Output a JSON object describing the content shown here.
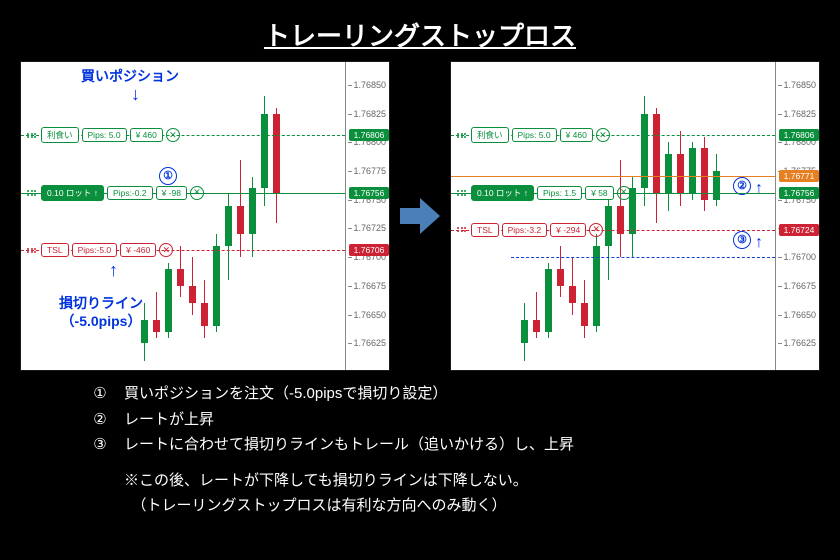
{
  "title": "トレーリングストップロス",
  "annot": {
    "buy_pos": "買いポジション",
    "sl_line_1": "損切りライン",
    "sl_line_2": "（-5.0pips）",
    "m1": "①",
    "m2": "②",
    "m3": "③"
  },
  "explain": {
    "n1": "①",
    "t1": "買いポジションを注文（-5.0pipsで損切り設定）",
    "n2": "②",
    "t2": "レートが上昇",
    "n3": "③",
    "t3": "レートに合わせて損切りラインもトレール（追いかける）し、上昇",
    "note1": "※この後、レートが下降しても損切りラインは下降しない。",
    "note2": "　（トレーリングストップロスは有利な方向へのみ動く）"
  },
  "chart_data": [
    {
      "type": "candlestick",
      "ylim": [
        1.766,
        1.7687
      ],
      "yticks": [
        1.76625,
        1.7665,
        1.76675,
        1.767,
        1.76725,
        1.7675,
        1.76775,
        1.768,
        1.76825,
        1.7685
      ],
      "lines": [
        {
          "label": "利食い",
          "pips": "Pips: 5.0",
          "amt": "¥ 460",
          "price": 1.76806,
          "color": "green",
          "style": "dash"
        },
        {
          "label": "0.10 ロット ↑",
          "pips": "Pips:-0.2",
          "amt": "¥ -98",
          "price": 1.76756,
          "color": "green",
          "style": "solid",
          "filled": true
        },
        {
          "label": "TSL",
          "pips": "Pips:-5.0",
          "amt": "¥ -460",
          "price": 1.76706,
          "color": "red",
          "style": "dash"
        }
      ],
      "candles": [
        {
          "x": 120,
          "o": 1.76625,
          "h": 1.7666,
          "l": 1.7661,
          "c": 1.76645,
          "up": true
        },
        {
          "x": 132,
          "o": 1.76645,
          "h": 1.7667,
          "l": 1.7663,
          "c": 1.76635,
          "up": false
        },
        {
          "x": 144,
          "o": 1.76635,
          "h": 1.76695,
          "l": 1.7663,
          "c": 1.7669,
          "up": true
        },
        {
          "x": 156,
          "o": 1.7669,
          "h": 1.7671,
          "l": 1.76665,
          "c": 1.76675,
          "up": false
        },
        {
          "x": 168,
          "o": 1.76675,
          "h": 1.767,
          "l": 1.7665,
          "c": 1.7666,
          "up": false
        },
        {
          "x": 180,
          "o": 1.7666,
          "h": 1.7668,
          "l": 1.7663,
          "c": 1.7664,
          "up": false
        },
        {
          "x": 192,
          "o": 1.7664,
          "h": 1.7672,
          "l": 1.76635,
          "c": 1.7671,
          "up": true
        },
        {
          "x": 204,
          "o": 1.7671,
          "h": 1.76755,
          "l": 1.7668,
          "c": 1.76745,
          "up": true
        },
        {
          "x": 216,
          "o": 1.76745,
          "h": 1.76785,
          "l": 1.767,
          "c": 1.7672,
          "up": false
        },
        {
          "x": 228,
          "o": 1.7672,
          "h": 1.7677,
          "l": 1.767,
          "c": 1.7676,
          "up": true
        },
        {
          "x": 240,
          "o": 1.7676,
          "h": 1.7684,
          "l": 1.76745,
          "c": 1.76825,
          "up": true
        },
        {
          "x": 252,
          "o": 1.76825,
          "h": 1.7683,
          "l": 1.7673,
          "c": 1.76755,
          "up": false
        }
      ]
    },
    {
      "type": "candlestick",
      "ylim": [
        1.766,
        1.7687
      ],
      "yticks": [
        1.76625,
        1.7665,
        1.76675,
        1.767,
        1.76725,
        1.7675,
        1.76775,
        1.768,
        1.76825,
        1.7685
      ],
      "lines": [
        {
          "label": "利食い",
          "pips": "Pips: 5.0",
          "amt": "¥ 460",
          "price": 1.76806,
          "color": "green",
          "style": "dash"
        },
        {
          "label": "",
          "pips": "",
          "amt": "",
          "price": 1.76771,
          "color": "orange",
          "style": "solid",
          "priceonly": true
        },
        {
          "label": "0.10 ロット ↑",
          "pips": "Pips: 1.5",
          "amt": "¥ 58",
          "price": 1.76756,
          "color": "green",
          "style": "solid",
          "filled": true
        },
        {
          "label": "TSL",
          "pips": "Pips:-3.2",
          "amt": "¥ -294",
          "price": 1.76724,
          "color": "red",
          "style": "dash"
        },
        {
          "label": "",
          "pips": "",
          "amt": "",
          "price": 1.767,
          "color": "blue",
          "style": "dash",
          "refonly": true
        }
      ],
      "candles": [
        {
          "x": 70,
          "o": 1.76625,
          "h": 1.7666,
          "l": 1.7661,
          "c": 1.76645,
          "up": true
        },
        {
          "x": 82,
          "o": 1.76645,
          "h": 1.7667,
          "l": 1.7663,
          "c": 1.76635,
          "up": false
        },
        {
          "x": 94,
          "o": 1.76635,
          "h": 1.76695,
          "l": 1.7663,
          "c": 1.7669,
          "up": true
        },
        {
          "x": 106,
          "o": 1.7669,
          "h": 1.7671,
          "l": 1.76665,
          "c": 1.76675,
          "up": false
        },
        {
          "x": 118,
          "o": 1.76675,
          "h": 1.767,
          "l": 1.7665,
          "c": 1.7666,
          "up": false
        },
        {
          "x": 130,
          "o": 1.7666,
          "h": 1.7668,
          "l": 1.7663,
          "c": 1.7664,
          "up": false
        },
        {
          "x": 142,
          "o": 1.7664,
          "h": 1.7672,
          "l": 1.76635,
          "c": 1.7671,
          "up": true
        },
        {
          "x": 154,
          "o": 1.7671,
          "h": 1.76755,
          "l": 1.7668,
          "c": 1.76745,
          "up": true
        },
        {
          "x": 166,
          "o": 1.76745,
          "h": 1.76785,
          "l": 1.767,
          "c": 1.7672,
          "up": false
        },
        {
          "x": 178,
          "o": 1.7672,
          "h": 1.7677,
          "l": 1.767,
          "c": 1.7676,
          "up": true
        },
        {
          "x": 190,
          "o": 1.7676,
          "h": 1.7684,
          "l": 1.76745,
          "c": 1.76825,
          "up": true
        },
        {
          "x": 202,
          "o": 1.76825,
          "h": 1.7683,
          "l": 1.7673,
          "c": 1.76755,
          "up": false
        },
        {
          "x": 214,
          "o": 1.76755,
          "h": 1.768,
          "l": 1.7674,
          "c": 1.7679,
          "up": true
        },
        {
          "x": 226,
          "o": 1.7679,
          "h": 1.7681,
          "l": 1.76745,
          "c": 1.76755,
          "up": false
        },
        {
          "x": 238,
          "o": 1.76755,
          "h": 1.768,
          "l": 1.7675,
          "c": 1.76795,
          "up": true
        },
        {
          "x": 250,
          "o": 1.76795,
          "h": 1.76805,
          "l": 1.7674,
          "c": 1.7675,
          "up": false
        },
        {
          "x": 262,
          "o": 1.7675,
          "h": 1.7679,
          "l": 1.76745,
          "c": 1.76775,
          "up": true
        }
      ]
    }
  ]
}
